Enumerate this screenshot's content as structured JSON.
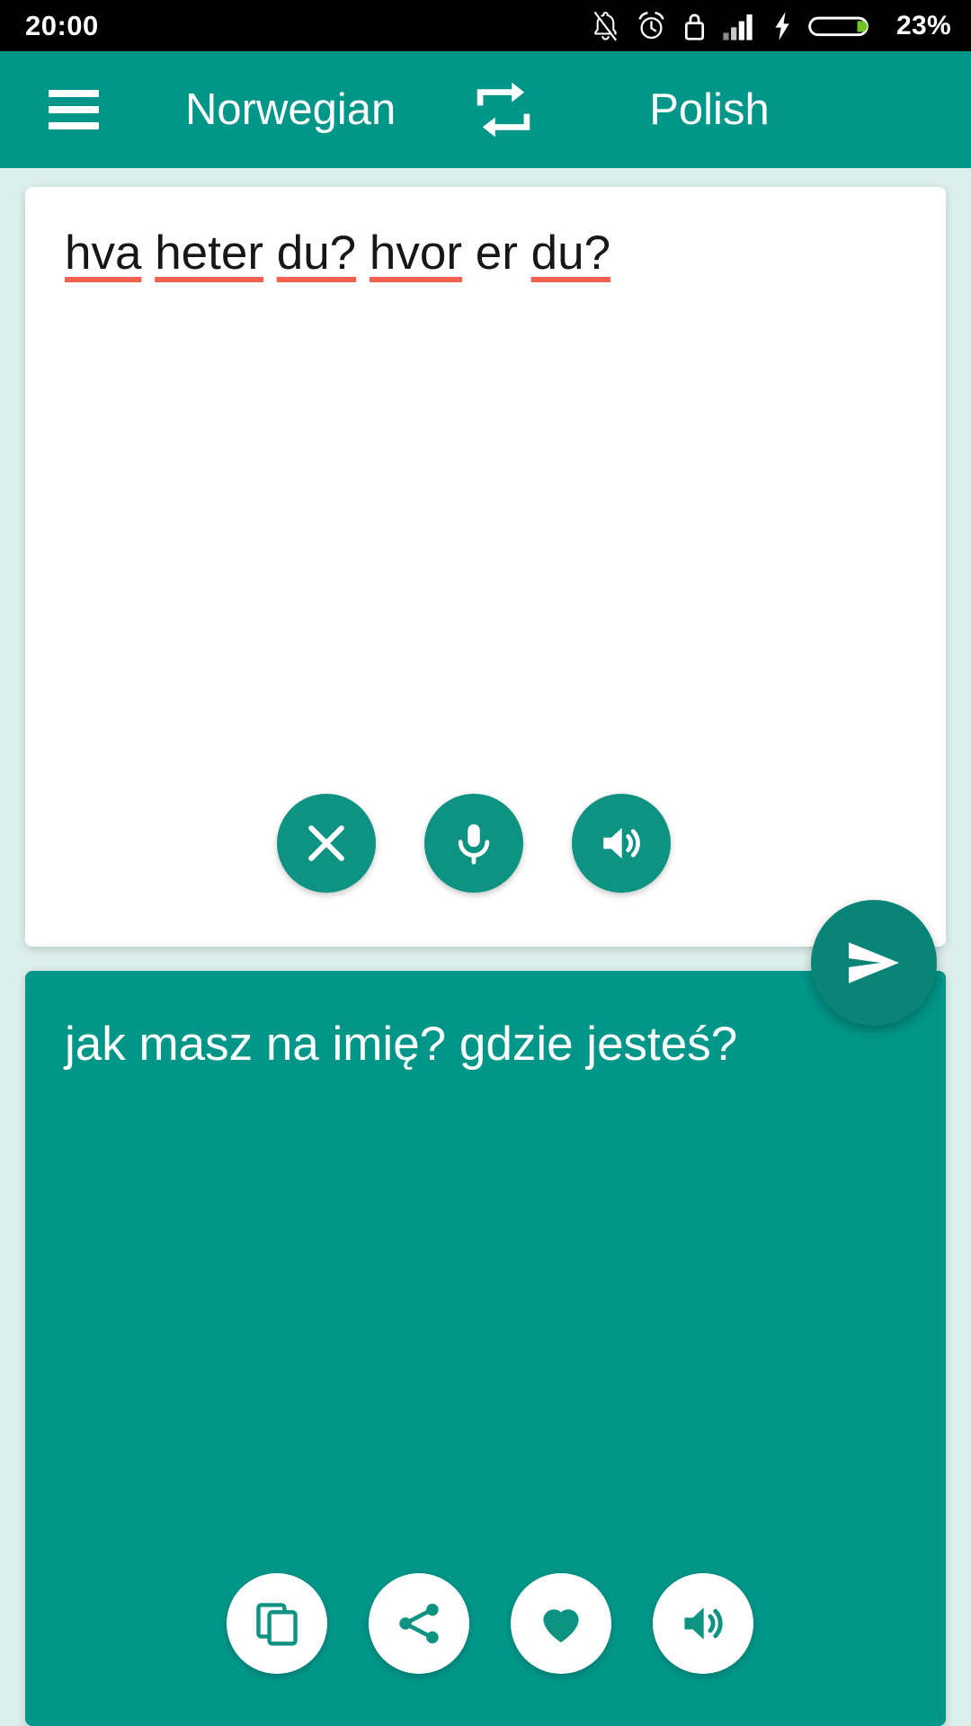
{
  "status_bar": {
    "time": "20:00",
    "battery_percent": "23%",
    "icons": [
      "bell-muted-icon",
      "alarm-clock-icon",
      "lock-icon",
      "signal-bars-icon",
      "charging-bolt-icon",
      "battery-icon"
    ]
  },
  "header": {
    "menu_icon": "hamburger-menu-icon",
    "source_language": "Norwegian",
    "swap_icon": "swap-languages-icon",
    "target_language": "Polish"
  },
  "source_panel": {
    "text": "hva heter du? hvor er du?",
    "tokens": [
      {
        "word": "hva",
        "misspelled": true
      },
      {
        "word": "heter",
        "misspelled": true
      },
      {
        "word": "du?",
        "misspelled": true
      },
      {
        "word": "hvor",
        "misspelled": true
      },
      {
        "word": "er",
        "misspelled": false
      },
      {
        "word": "du?",
        "misspelled": true
      }
    ],
    "actions": [
      {
        "name": "clear-button",
        "icon": "close-icon"
      },
      {
        "name": "microphone-button",
        "icon": "microphone-icon"
      },
      {
        "name": "speak-button",
        "icon": "speaker-icon"
      }
    ]
  },
  "send_button": {
    "name": "translate-send-button",
    "icon": "send-icon"
  },
  "target_panel": {
    "text": "jak masz na imię? gdzie jesteś?",
    "actions": [
      {
        "name": "copy-button",
        "icon": "copy-icon"
      },
      {
        "name": "share-button",
        "icon": "share-icon"
      },
      {
        "name": "favorite-button",
        "icon": "heart-icon"
      },
      {
        "name": "speak-button",
        "icon": "speaker-icon"
      }
    ]
  },
  "colors": {
    "accent_teal": "#009688",
    "fab_teal": "#0e9382",
    "send_fab_teal": "#0a8476",
    "page_background": "#ddefec",
    "status_bar_background": "#000000",
    "spellcheck_underline": "#f4604f",
    "battery_green": "#6fc320",
    "card_white": "#ffffff"
  }
}
